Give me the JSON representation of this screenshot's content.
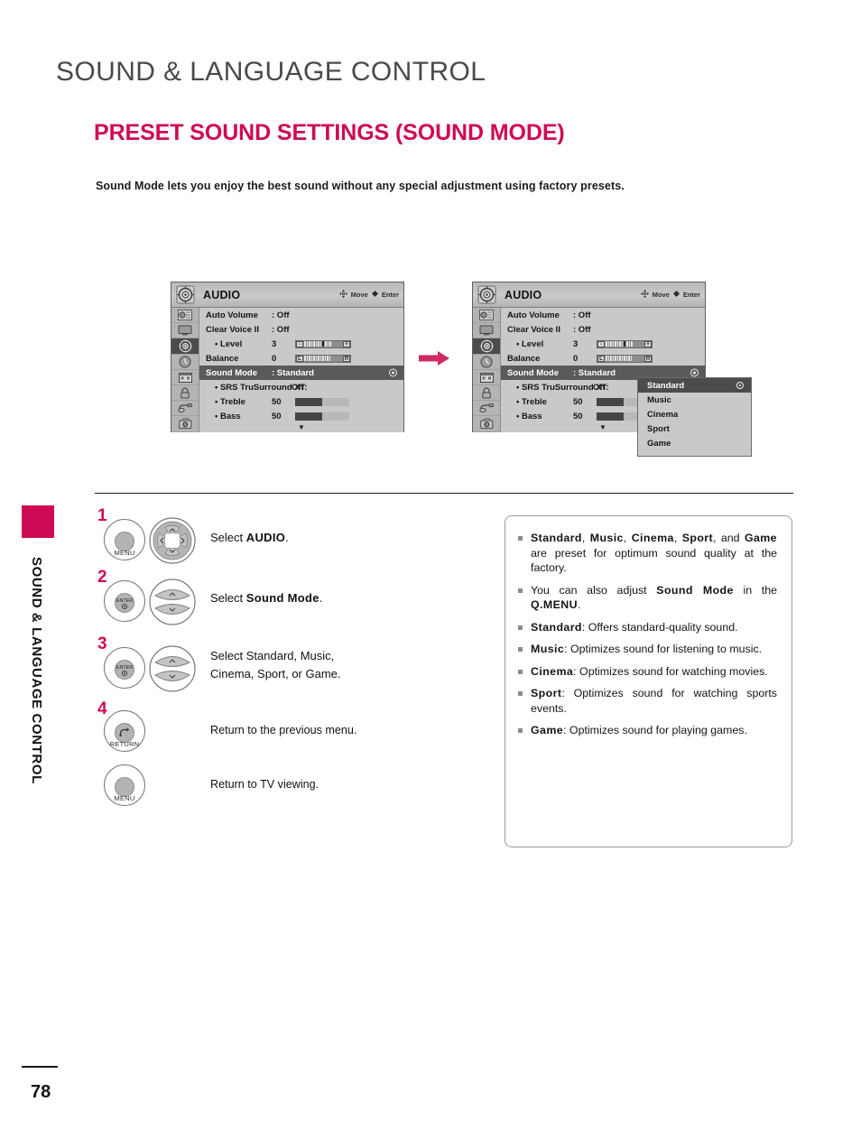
{
  "document": {
    "chapter_title": "SOUND & LANGUAGE CONTROL",
    "section_title": "PRESET SOUND SETTINGS (SOUND MODE)",
    "intro": "Sound Mode lets you enjoy the best sound without any special adjustment using factory presets.",
    "edge_tab_label": "SOUND & LANGUAGE CONTROL",
    "page_number": "78",
    "accent_color": "#cf0a55"
  },
  "osd": {
    "title": "AUDIO",
    "hint_move": "Move",
    "hint_enter": "Enter",
    "rows": [
      {
        "label": "Auto Volume",
        "value": ": Off"
      },
      {
        "label": "Clear Voice II",
        "value": ": Off"
      },
      {
        "sub": "• Level",
        "num": "3"
      },
      {
        "label": "Balance",
        "num": "0"
      },
      {
        "label": "Sound Mode",
        "value": ": Standard",
        "selected": true
      },
      {
        "sub": "• SRS TruSurround XT:",
        "num": "Off"
      },
      {
        "sub": "• Treble",
        "num": "50"
      },
      {
        "sub": "• Bass",
        "num": "50"
      }
    ],
    "scroll_down_glyph": "▼",
    "level_value": "3",
    "balance_value": "0",
    "balance_left_cap": "L",
    "balance_right_cap": "R",
    "level_minus_cap": "-",
    "level_plus_cap": "+",
    "treble_percent": 50,
    "bass_percent": 50,
    "rail_icons": [
      "picture-icon",
      "screen-icon",
      "audio-icon",
      "time-icon",
      "setup-icon",
      "lock-icon",
      "input-icon",
      "usb-icon"
    ],
    "selected_rail_index": 2,
    "popup_items": [
      "Standard",
      "Music",
      "Cinema",
      "Sport",
      "Game"
    ],
    "popup_selected": "Standard"
  },
  "steps": [
    {
      "number": "1",
      "buttons": [
        "MENU",
        "nav-pad"
      ],
      "text_prefix": "Select ",
      "text_bold": "AUDIO",
      "text_suffix": "."
    },
    {
      "number": "2",
      "buttons": [
        "ENTER",
        "up-down"
      ],
      "text_prefix": "Select ",
      "text_bold": "Sound Mode",
      "text_suffix": "."
    },
    {
      "number": "3",
      "buttons": [
        "ENTER",
        "up-down"
      ],
      "text_line1": "Select Standard, Music,",
      "text_line2": "Cinema, Sport, or Game."
    },
    {
      "number": "4",
      "buttons": [
        "RETURN"
      ],
      "text": "Return to the previous menu."
    },
    {
      "number": "",
      "buttons": [
        "MENU"
      ],
      "text": "Return to TV viewing."
    }
  ],
  "button_captions": {
    "menu": "MENU",
    "enter": "ENTER",
    "return": "RETURN"
  },
  "notes": [
    "Standard, Music, Cinema, Sport, and Game are preset for optimum sound quality at the factory.",
    "You can also adjust Sound Mode in the Q.MENU.",
    "Standard: Offers standard-quality sound.",
    "Music: Optimizes sound for listening to music.",
    "Cinema: Optimizes sound for watching movies.",
    "Sport: Optimizes sound for watching sports events.",
    "Game: Optimizes sound for playing games."
  ],
  "notes_rich": [
    {
      "bold_parts": [
        "Standard",
        "Music",
        "Cinema",
        "Sport",
        "Game"
      ],
      "tail": "are preset for optimum sound quality at the factory."
    },
    {
      "lead": "You can also adjust ",
      "bold": "Sound Mode",
      "mid": " in the ",
      "bold2": "Q.MENU",
      "tail": "."
    },
    {
      "bold": "Standard",
      "tail": ": Offers standard-quality sound."
    },
    {
      "bold": "Music",
      "tail": ": Optimizes sound for listening to music."
    },
    {
      "bold": "Cinema",
      "tail": ": Optimizes sound for watching movies."
    },
    {
      "bold": "Sport",
      "tail": ": Optimizes sound for watching sports events."
    },
    {
      "bold": "Game",
      "tail": ": Optimizes sound for playing games."
    }
  ]
}
